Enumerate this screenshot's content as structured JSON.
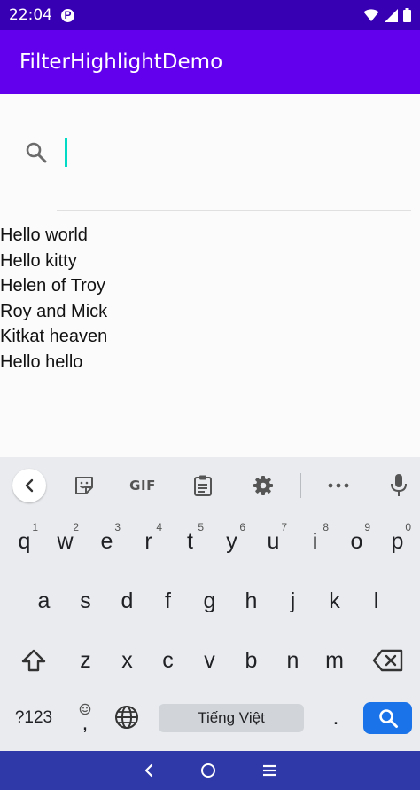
{
  "status_bar": {
    "time": "22:04",
    "badge": "P"
  },
  "app_bar": {
    "title": "FilterHighlightDemo"
  },
  "search": {
    "value": "",
    "placeholder": ""
  },
  "list": [
    "Hello world",
    "Hello kitty",
    "Helen of Troy",
    "Roy and Mick",
    "Kitkat heaven",
    "Hello hello"
  ],
  "keyboard": {
    "toolbar": {
      "gif_label": "GIF"
    },
    "row1": [
      {
        "key": "q",
        "num": "1"
      },
      {
        "key": "w",
        "num": "2"
      },
      {
        "key": "e",
        "num": "3"
      },
      {
        "key": "r",
        "num": "4"
      },
      {
        "key": "t",
        "num": "5"
      },
      {
        "key": "y",
        "num": "6"
      },
      {
        "key": "u",
        "num": "7"
      },
      {
        "key": "i",
        "num": "8"
      },
      {
        "key": "o",
        "num": "9"
      },
      {
        "key": "p",
        "num": "0"
      }
    ],
    "row2": [
      "a",
      "s",
      "d",
      "f",
      "g",
      "h",
      "j",
      "k",
      "l"
    ],
    "row3": [
      "z",
      "x",
      "c",
      "v",
      "b",
      "n",
      "m"
    ],
    "mode_label": "?123",
    "comma_label": ",",
    "space_label": "Tiếng Việt",
    "period_label": "."
  },
  "colors": {
    "app_bar": "#6200ee",
    "status_bar": "#3700b3",
    "cursor": "#03dac5",
    "enter_key": "#1a73e8",
    "nav_bar": "#3039a8"
  }
}
